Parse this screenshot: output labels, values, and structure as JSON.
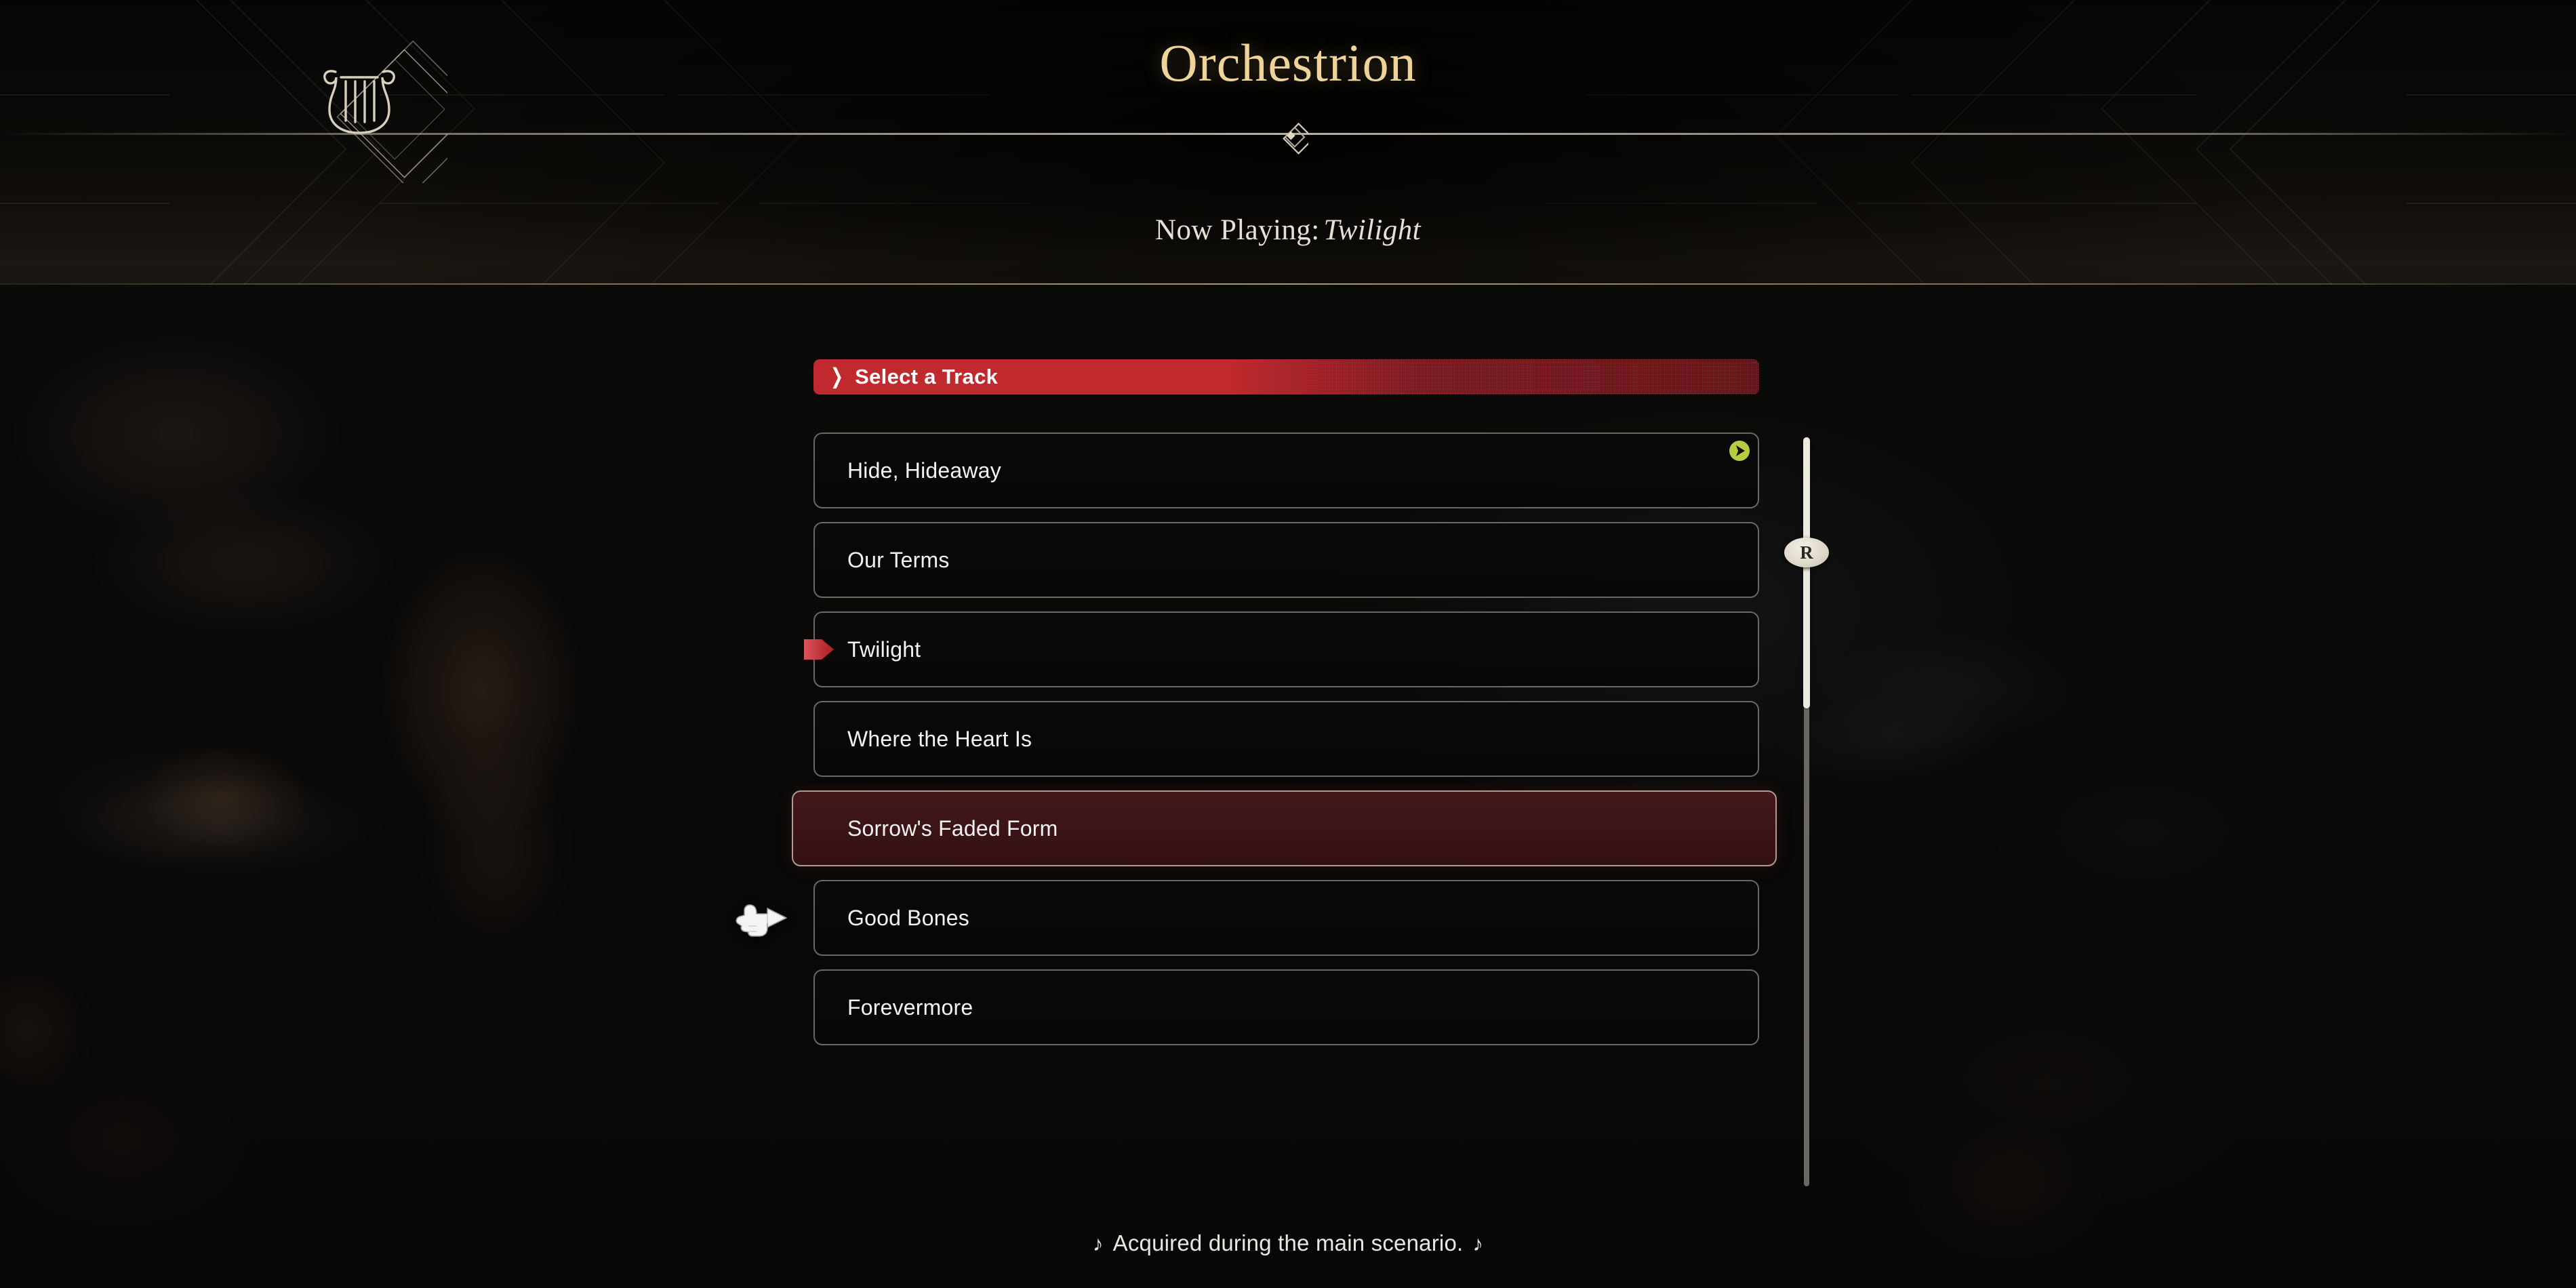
{
  "header": {
    "logo_icon": "lyre-icon",
    "title": "Orchestrion",
    "ornament_icon": "diamond-ornament-icon",
    "now_playing_prefix": "Now Playing:",
    "now_playing_track": "Twilight"
  },
  "section": {
    "chevron_icon": "chevron-right-icon",
    "label": "Select a Track",
    "accent_color": "#c0292e"
  },
  "tracks": [
    {
      "label": "Hide, Hideaway",
      "state": "normal",
      "play_badge": true,
      "now_playing": false
    },
    {
      "label": "Our Terms",
      "state": "normal",
      "play_badge": false,
      "now_playing": false
    },
    {
      "label": "Twilight",
      "state": "normal",
      "play_badge": false,
      "now_playing": true
    },
    {
      "label": "Where the Heart Is",
      "state": "normal",
      "play_badge": false,
      "now_playing": false
    },
    {
      "label": "Sorrow's Faded Form",
      "state": "selected",
      "play_badge": false,
      "now_playing": false
    },
    {
      "label": "Good Bones",
      "state": "normal",
      "play_badge": false,
      "now_playing": false
    },
    {
      "label": "Forevermore",
      "state": "normal",
      "play_badge": false,
      "now_playing": false
    }
  ],
  "scrollbar": {
    "button_label": "R",
    "thumb_color": "#eceadf",
    "track_color": "#6b6762"
  },
  "cursor": {
    "icon": "pointing-hand-cursor"
  },
  "footer": {
    "note_left": "♪",
    "text": "Acquired during the main scenario.",
    "note_right": "♪"
  },
  "colors": {
    "accent_red": "#c0292e",
    "title_gold": "#efd49a",
    "play_badge_green": "#b9cc3f",
    "selected_row_fill": "#3a1417",
    "selected_row_border": "#b39a8e",
    "row_border": "#6b6762"
  }
}
